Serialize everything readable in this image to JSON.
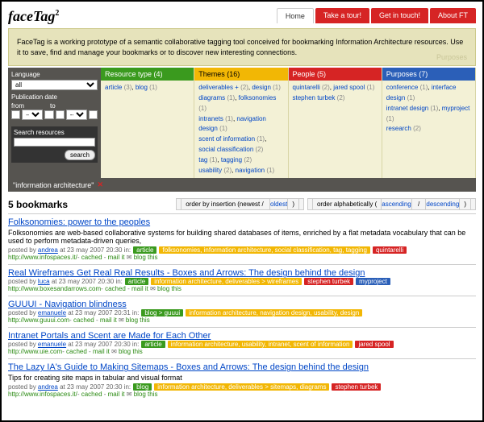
{
  "logo": "faceTag",
  "logoSup": "2",
  "nav": [
    {
      "label": "Home",
      "cls": "home"
    },
    {
      "label": "Take a tour!",
      "cls": "red"
    },
    {
      "label": "Get in touch!",
      "cls": "red"
    },
    {
      "label": "About FT",
      "cls": "red"
    }
  ],
  "banner": {
    "text": "FaceTag is a working prototype of a semantic collaborative tagging tool conceived for bookmarking Information Architecture resources. Use it to save, find and manage your bookmarks or to discover new interesting connections.",
    "faint": "Purposes"
  },
  "side": {
    "langLabel": "Language",
    "langValue": "all",
    "pubLabel": "Publication date",
    "from": "from",
    "to": "to",
    "searchLabel": "Search resources",
    "searchBtn": "search"
  },
  "facets": [
    {
      "title": "Resource type (4)",
      "cls": "h-green",
      "items": [
        [
          "article",
          "(3)"
        ],
        [
          "blog",
          "(1)"
        ]
      ]
    },
    {
      "title": "Themes (16)",
      "cls": "h-yellow",
      "items": [
        [
          "deliverables +",
          "(2)"
        ],
        [
          "design",
          "(1)"
        ],
        [
          "diagrams",
          "(1)"
        ],
        [
          "folksonomies",
          "(1)"
        ],
        [
          "intranets",
          "(1)"
        ],
        [
          "navigation design",
          "(1)"
        ],
        [
          "scent of information",
          "(1)"
        ],
        [
          "social classification",
          "(2)"
        ],
        [
          "tag",
          "(1)"
        ],
        [
          "tagging",
          "(2)"
        ],
        [
          "usability",
          "(2)"
        ],
        [
          "navigation",
          "(1)"
        ]
      ]
    },
    {
      "title": "People (5)",
      "cls": "h-red",
      "items": [
        [
          "quintarelli",
          "(2)"
        ],
        [
          "jared spool",
          "(1)"
        ],
        [
          "stephen turbek",
          "(2)"
        ]
      ]
    },
    {
      "title": "Purposes (7)",
      "cls": "h-blue",
      "items": [
        [
          "conference",
          "(1)"
        ],
        [
          "interface design",
          "(1)"
        ],
        [
          "intranet design",
          "(1)"
        ],
        [
          "myproject",
          "(1)"
        ],
        [
          "research",
          "(2)"
        ]
      ]
    }
  ],
  "filter": {
    "text": "\"information architecture\"",
    "x": "✕"
  },
  "results": {
    "heading": "5 bookmarks",
    "orderInsert": {
      "prefix": "order by insertion (newest / ",
      "link": "oldest",
      "suffix": ")"
    },
    "orderAlpha": {
      "prefix": "order alphabetically (",
      "link1": "ascending",
      "mid": " / ",
      "link2": "descending",
      "suffix": ")"
    }
  },
  "bookmarks": [
    {
      "title": "Folksonomies: power to the peoples",
      "desc": "Folksonomies are web-based collaborative systems for building shared databases of items, enriched by a flat metadata vocabulary that can be used to perform metadata-driven queries,",
      "poster": "andrea",
      "date": "at 23 may 2007 20:30 in:",
      "tags": [
        {
          "t": "article",
          "c": "t-green"
        },
        {
          "t": "folksonomies, information architecture, social classification, tag, tagging",
          "c": "t-yellow"
        },
        {
          "t": "quintarelli",
          "c": "t-red"
        }
      ],
      "url": "http://www.infospaces.it/"
    },
    {
      "title": "Real Wireframes Get Real Real Results - Boxes and Arrows: The design behind the design",
      "desc": "",
      "poster": "luca",
      "date": "at 23 may 2007 20:30 in:",
      "tags": [
        {
          "t": "article",
          "c": "t-green"
        },
        {
          "t": "information architecture, deliverables > wireframes",
          "c": "t-yellow"
        },
        {
          "t": "stephen turbek",
          "c": "t-red"
        },
        {
          "t": "myproject",
          "c": "t-blue"
        }
      ],
      "url": "http://www.boxesandarrows.com"
    },
    {
      "title": "GUUUI - Navigation blindness",
      "desc": "",
      "poster": "emanuele",
      "date": "at 23 may 2007 20:31 in:",
      "tags": [
        {
          "t": "blog > guuui",
          "c": "t-green"
        },
        {
          "t": "information architecture, navigation design, usability, design",
          "c": "t-yellow"
        }
      ],
      "url": "http://www.guuui.com"
    },
    {
      "title": "Intranet Portals and Scent are Made for Each Other",
      "desc": "",
      "poster": "emanuele",
      "date": "at 23 may 2007 20:30 in:",
      "tags": [
        {
          "t": "article",
          "c": "t-green"
        },
        {
          "t": "information architecture, usability, intranet, scent of information",
          "c": "t-yellow"
        },
        {
          "t": "jared spool",
          "c": "t-red"
        }
      ],
      "url": "http://www.uie.com"
    },
    {
      "title": "The Lazy IA's Guide to Making Sitemaps - Boxes and Arrows: The design behind the design",
      "desc": "Tips for creating site maps in tabular and visual format",
      "poster": "andrea",
      "date": "at 23 may 2007 20:30 in:",
      "tags": [
        {
          "t": "blog",
          "c": "t-green"
        },
        {
          "t": "information architecture, deliverables > sitemaps, diagrams",
          "c": "t-yellow"
        },
        {
          "t": "stephen turbek",
          "c": "t-red"
        }
      ],
      "url": "http://www.infospaces.it/"
    }
  ],
  "linkTrail": {
    "cached": "cached",
    "mailit": "mail it",
    "blogthis": "blog this",
    "sep": " - ",
    "envelope": "✉",
    "postedBy": "posted by "
  }
}
